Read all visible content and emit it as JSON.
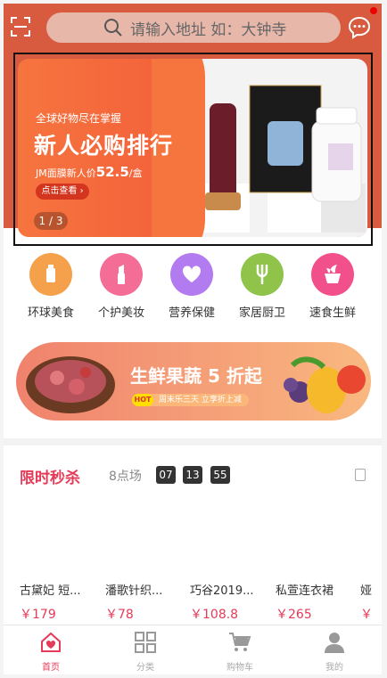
{
  "header": {
    "search_placeholder": "请输入地址 如：大钟寺",
    "accent": "#d85b3f"
  },
  "banner": {
    "subtitle": "全球好物尽在掌握",
    "title": "新人必购排行",
    "price_prefix": "JM面膜新人价",
    "price": "52.5",
    "price_suffix": "/盒",
    "button": "点击查看 ›",
    "page": "1 / 3"
  },
  "categories": [
    {
      "label": "环球美食",
      "icon": "milk-icon",
      "color": "#f5a04a"
    },
    {
      "label": "个护美妆",
      "icon": "lipstick-icon",
      "color": "#f36d96"
    },
    {
      "label": "营养保健",
      "icon": "heart-icon",
      "color": "#b37bf0"
    },
    {
      "label": "家居厨卫",
      "icon": "fork-icon",
      "color": "#8fc34a"
    },
    {
      "label": "速食生鲜",
      "icon": "bowl-icon",
      "color": "#f2508b"
    }
  ],
  "promo": {
    "title": "生鲜果蔬 5 折起",
    "hot": "HOT",
    "tag": "周末乐三天 立享折上减"
  },
  "flash_sale": {
    "title": "限时秒杀",
    "session": "8点场",
    "hours": "07",
    "minutes": "13",
    "seconds": "55",
    "products": [
      {
        "name": "古黛妃 短...",
        "price": "￥179"
      },
      {
        "name": "潘歌针织...",
        "price": "￥78"
      },
      {
        "name": "巧谷2019...",
        "price": "￥108.8"
      },
      {
        "name": "私萱连衣裙",
        "price": "￥265"
      },
      {
        "name": "娅",
        "price": "￥"
      }
    ]
  },
  "tabbar": [
    {
      "label": "首页",
      "icon": "home-icon"
    },
    {
      "label": "分类",
      "icon": "grid-icon"
    },
    {
      "label": "购物车",
      "icon": "cart-icon"
    },
    {
      "label": "我的",
      "icon": "user-icon"
    }
  ]
}
